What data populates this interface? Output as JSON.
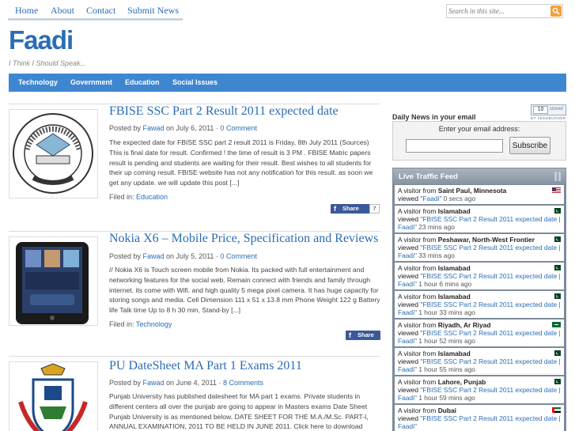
{
  "topnav": {
    "items": [
      "Home",
      "About",
      "Contact",
      "Submit News"
    ]
  },
  "search": {
    "placeholder": "Search in this site..."
  },
  "site": {
    "title": "Faadi",
    "tagline": "I Think I Should Speak..."
  },
  "categories": [
    "Technology",
    "Government",
    "Education",
    "Social Issues"
  ],
  "posts": [
    {
      "title": "FBISE SSC Part 2 Result 2011 expected date",
      "meta_prefix": "Posted by ",
      "author": "Fawad",
      "meta_date": " on July 6, 2011 · ",
      "comments": "0 Comment",
      "excerpt": "The expected date for FBISE SSC part 2 result 2011 is Friday, 8th July 2011 (Sources) This is final date for result. Confirmed ! the time of result is 3 PM . FBISE Matric papers result is pending and students are waiting for their result. Best wishes to all students for their up coming result. FBISE website has not any notification for this result. as soon we get any update. we will update this post [...]",
      "filed_label": "Filed in: ",
      "category": "Education",
      "share_label": "Share",
      "share_count": "7"
    },
    {
      "title": "Nokia X6 – Mobile Price, Specification and Reviews",
      "meta_prefix": "Posted by ",
      "author": "Fawad",
      "meta_date": " on July 5, 2011 · ",
      "comments": "0 Comment",
      "excerpt": "// Nokia X6 is Touch screen mobile from Nokia. Its packed with full entertainment and networking features for the social web. Remain connect with friends and family through internet. its come with Wifi. and high quality 5 mega pixel camera. It has huge capacity for storing songs and media. Cell Dimension 111 x 51 x 13.8 mm Phone Weight 122 g Battery life Talk time Up to 8 h 30 min, Stand-by [...]",
      "filed_label": "Filed in: ",
      "category": "Technology",
      "share_label": "Share"
    },
    {
      "title": "PU DateSheet MA Part 1 Exams 2011",
      "meta_prefix": "Posted by ",
      "author": "Fawad",
      "meta_date": " on June 4, 2011 · ",
      "comments": "8 Comments",
      "excerpt": "Punjab University has published datesheet for MA part 1 exams. Private students in different centers all over the punjab are going to appear in Masters exams Date Sheet Punjab University is as mentioned below. DATE SHEET FOR THE M.A./M.Sc. PART-I, ANNUAL EXAMINATION, 2011 TO BE HELD IN JUNE 2011. Click here to download WRITTEN"
    }
  ],
  "sidebar": {
    "daily_title": "Daily News in your email",
    "counter": {
      "number": "10",
      "text": "stored",
      "caption": "BY FEEDBURNER"
    },
    "email_label": "Enter your email address:",
    "subscribe_label": "Subscribe",
    "feed_title": "Live Traffic Feed",
    "feed": [
      {
        "prefix": "A visitor from ",
        "location": "Saint Paul, Minnesota",
        "viewed": "viewed ",
        "page": "\"Faadi\"",
        "ago": " 0 secs ago",
        "flag": "us"
      },
      {
        "prefix": "A visitor from ",
        "location": "Islamabad",
        "viewed": "viewed ",
        "page": "\"FBISE SSC Part 2 Result 2011 expected date | Faadi\"",
        "ago": " 23 mins ago",
        "flag": "pk"
      },
      {
        "prefix": "A visitor from ",
        "location": "Peshawar, North-West Frontier",
        "viewed": "viewed ",
        "page": "\"FBISE SSC Part 2 Result 2011 expected date | Faadi\"",
        "ago": " 33 mins ago",
        "flag": "pk"
      },
      {
        "prefix": "A visitor from ",
        "location": "Islamabad",
        "viewed": "viewed ",
        "page": "\"FBISE SSC Part 2 Result 2011 expected date | Faadi\"",
        "ago": " 1 hour 6 mins ago",
        "flag": "pk"
      },
      {
        "prefix": "A visitor from ",
        "location": "Islamabad",
        "viewed": "viewed ",
        "page": "\"FBISE SSC Part 2 Result 2011 expected date | Faadi\"",
        "ago": " 1 hour 33 mins ago",
        "flag": "pk"
      },
      {
        "prefix": "A visitor from ",
        "location": "Riyadh, Ar Riyad",
        "viewed": "viewed ",
        "page": "\"FBISE SSC Part 2 Result 2011 expected date | Faadi\"",
        "ago": " 1 hour 52 mins ago",
        "flag": "sa"
      },
      {
        "prefix": "A visitor from ",
        "location": "Islamabad",
        "viewed": "viewed ",
        "page": "\"FBISE SSC Part 2 Result 2011 expected date | Faadi\"",
        "ago": " 1 hour 55 mins ago",
        "flag": "pk"
      },
      {
        "prefix": "A visitor from ",
        "location": "Lahore, Punjab",
        "viewed": "viewed ",
        "page": "\"FBISE SSC Part 2 Result 2011 expected date | Faadi\"",
        "ago": " 1 hour 59 mins ago",
        "flag": "pk"
      },
      {
        "prefix": "A visitor from ",
        "location": "Dubai",
        "viewed": "viewed ",
        "page": "\"FBISE SSC Part 2 Result 2011 expected date | Faadi\"",
        "ago": "",
        "flag": "ae"
      }
    ]
  }
}
